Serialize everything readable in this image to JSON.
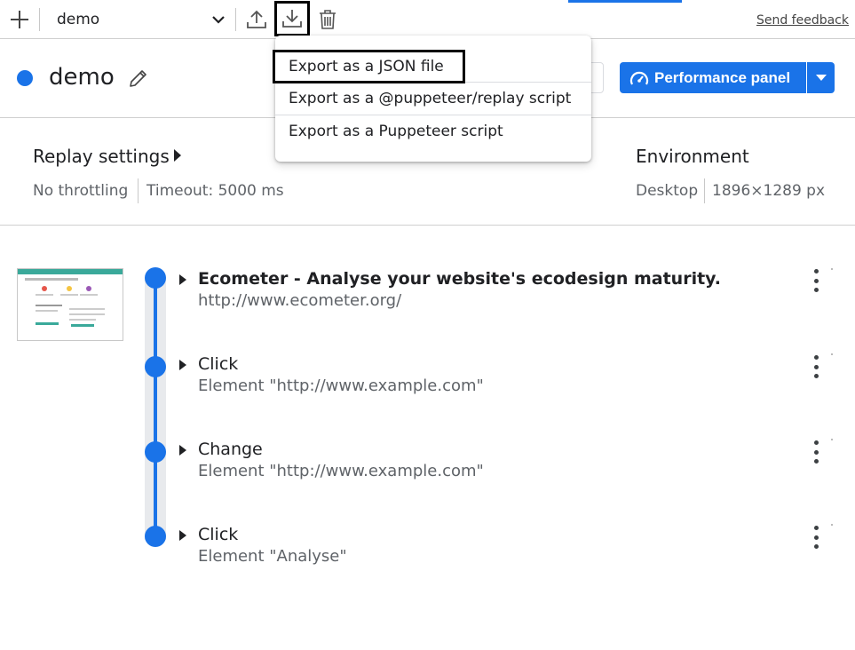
{
  "toolbar": {
    "recording_name": "demo",
    "send_feedback": "Send feedback",
    "icons": [
      "plus-icon",
      "chevron-down-icon",
      "upload-icon",
      "download-icon",
      "trash-icon"
    ]
  },
  "header": {
    "title": "demo",
    "performance_button": "Performance panel"
  },
  "export_menu": {
    "items": [
      "Export as a JSON file",
      "Export as a @puppeteer/replay script",
      "Export as a Puppeteer script"
    ]
  },
  "settings": {
    "replay_title": "Replay settings",
    "throttling": "No throttling",
    "timeout": "Timeout: 5000 ms",
    "environment_title": "Environment",
    "device": "Desktop",
    "viewport": "1896×1289 px"
  },
  "steps": [
    {
      "title": "Ecometer - Analyse your website's ecodesign maturity.",
      "subtitle": "http://www.ecometer.org/"
    },
    {
      "title": "Click",
      "subtitle": "Element \"http://www.example.com\""
    },
    {
      "title": "Change",
      "subtitle": "Element \"http://www.example.com\""
    },
    {
      "title": "Click",
      "subtitle": "Element \"Analyse\""
    }
  ],
  "colors": {
    "accent": "#1a73e8",
    "text": "#202124",
    "muted": "#5f6368"
  }
}
